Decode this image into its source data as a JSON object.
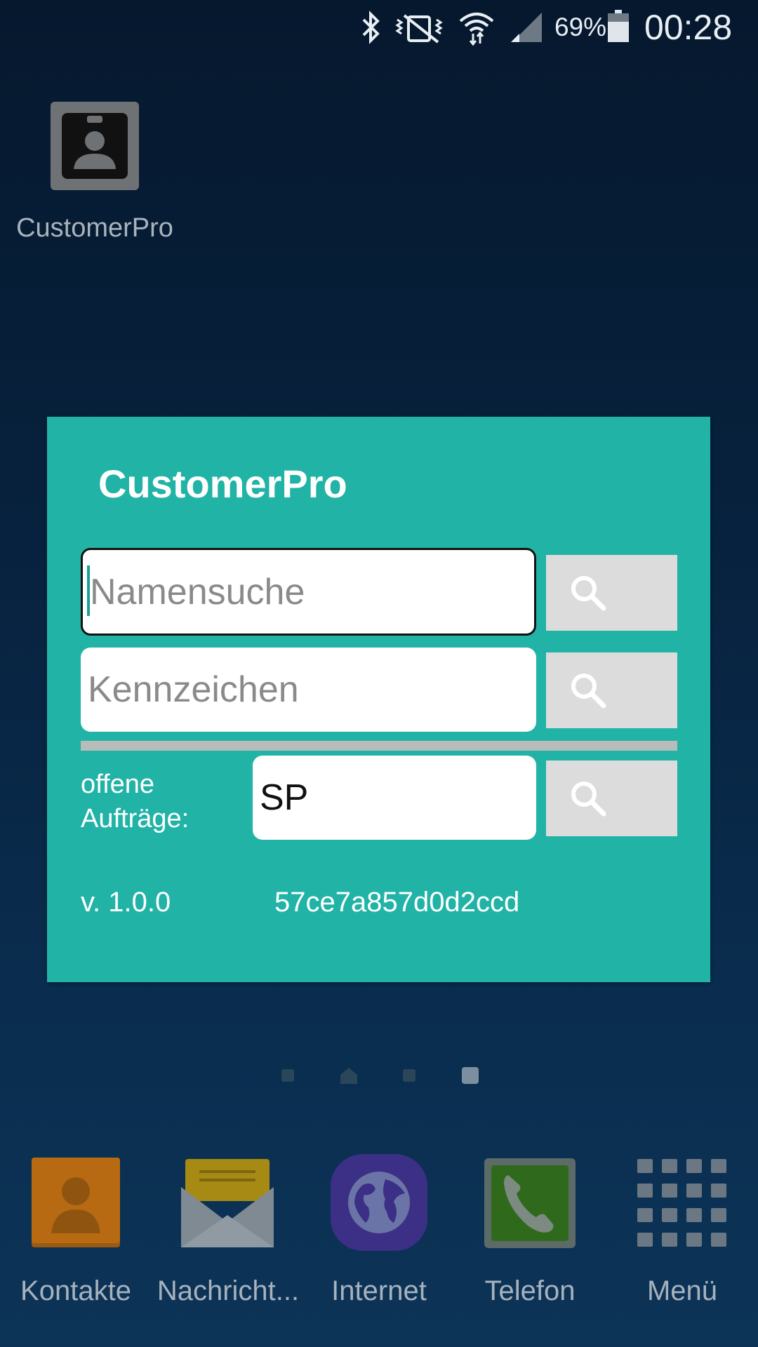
{
  "status_bar": {
    "battery_percent": "69%",
    "time": "00:28",
    "icons": [
      "bluetooth-icon",
      "vibrate-mute-icon",
      "wifi-icon",
      "signal-icon",
      "battery-icon"
    ]
  },
  "desktop": {
    "app_label": "CustomerPro"
  },
  "widget": {
    "title": "CustomerPro",
    "name_search": {
      "placeholder": "Namensuche",
      "value": ""
    },
    "plate_search": {
      "placeholder": "Kennzeichen",
      "value": ""
    },
    "open_orders": {
      "label_line1": "offene",
      "label_line2": "Aufträge:",
      "value": "SP"
    },
    "version": "v. 1.0.0",
    "hash": "57ce7a857d0d2ccd",
    "colors": {
      "background": "#21b3a6",
      "button": "#dcdcdc"
    }
  },
  "dock": {
    "items": [
      {
        "label": "Kontakte",
        "icon": "contacts-icon"
      },
      {
        "label": "Nachricht...",
        "icon": "messages-icon"
      },
      {
        "label": "Internet",
        "icon": "internet-icon"
      },
      {
        "label": "Telefon",
        "icon": "phone-icon"
      },
      {
        "label": "Menü",
        "icon": "apps-grid-icon"
      }
    ]
  }
}
